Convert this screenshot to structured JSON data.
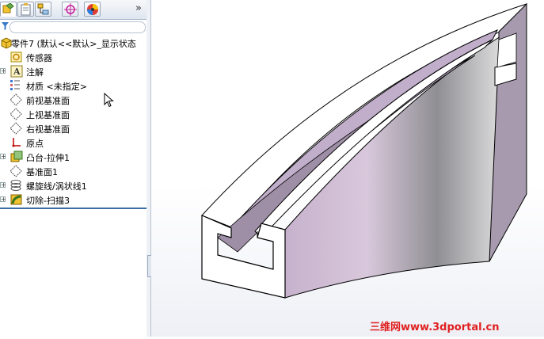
{
  "feature_manager": {
    "tabs": [
      {
        "name": "feature-tree",
        "active": true
      },
      {
        "name": "property-manager",
        "active": false
      },
      {
        "name": "configuration-manager",
        "active": false
      },
      {
        "name": "dimxpert-manager",
        "active": false
      },
      {
        "name": "display-manager",
        "active": false
      }
    ],
    "more_tabs_glyph": "»",
    "tree": [
      {
        "label": "零件7  (默认<<默认>_显示状态",
        "icon": "part-icon",
        "expander": false
      },
      {
        "label": "传感器",
        "icon": "sensor-icon",
        "expander": false
      },
      {
        "label": "注解",
        "icon": "annotation-icon",
        "expander": true
      },
      {
        "label": "材质 <未指定>",
        "icon": "material-icon",
        "expander": false
      },
      {
        "label": "前视基准面",
        "icon": "plane-icon",
        "expander": false
      },
      {
        "label": "上视基准面",
        "icon": "plane-icon",
        "expander": false
      },
      {
        "label": "右视基准面",
        "icon": "plane-icon",
        "expander": false
      },
      {
        "label": "原点",
        "icon": "origin-icon",
        "expander": false
      },
      {
        "label": "凸台-拉伸1",
        "icon": "boss-extrude-icon",
        "expander": true
      },
      {
        "label": "基准面1",
        "icon": "plane-icon",
        "expander": false
      },
      {
        "label": "螺旋线/涡状线1",
        "icon": "helix-icon",
        "expander": true
      },
      {
        "label": "切除-扫描3",
        "icon": "cut-sweep-icon",
        "expander": true
      }
    ]
  },
  "watermark": "三维网www.3dportal.cn",
  "colors": {
    "accent": "#3a6ea5",
    "model_face": "#c8b4cc",
    "watermark": "#e02020"
  }
}
